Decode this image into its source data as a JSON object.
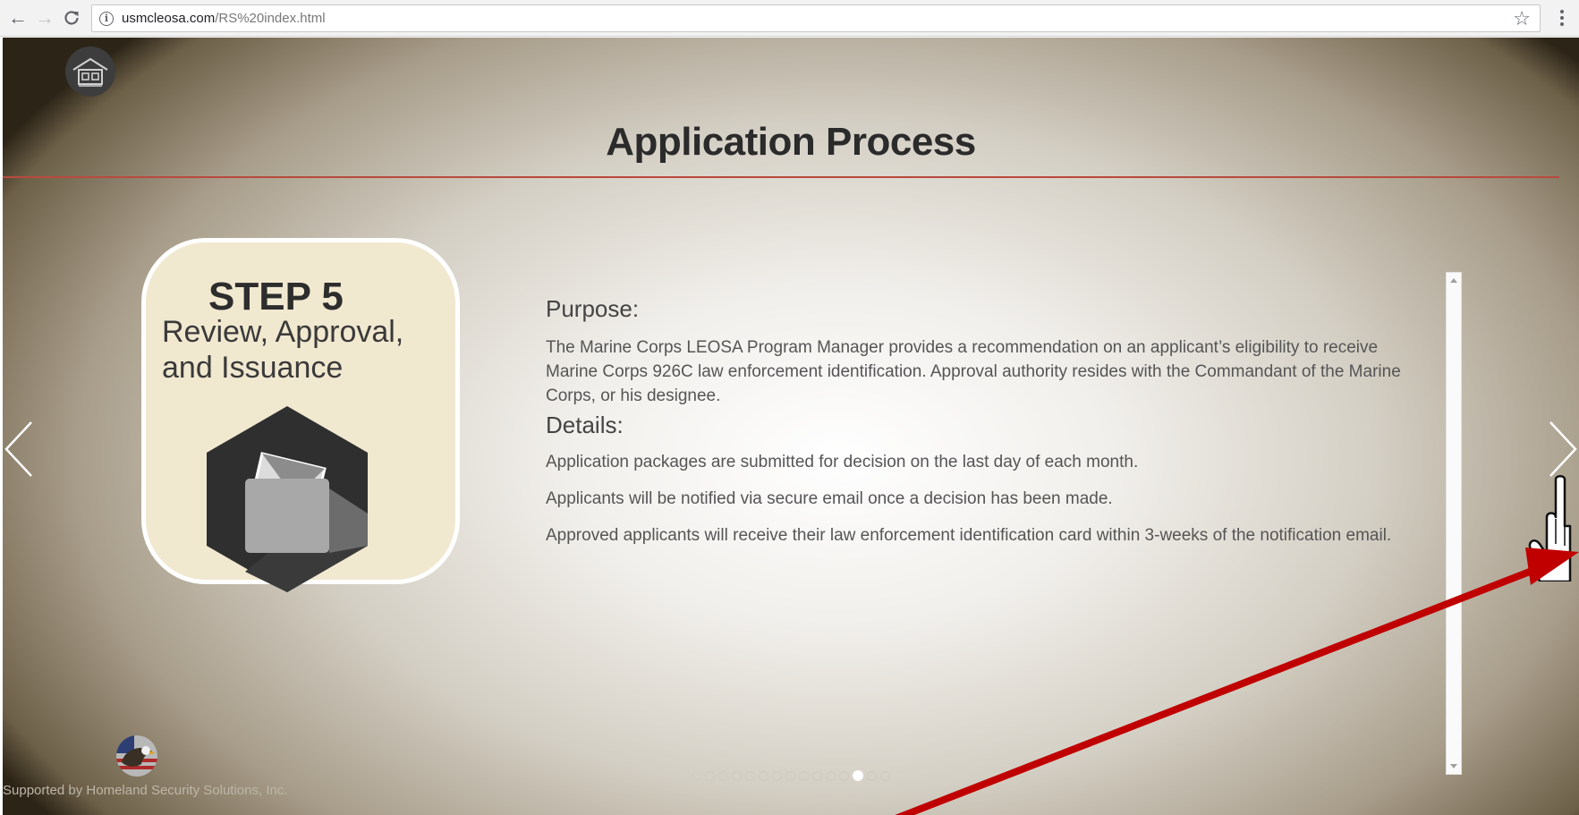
{
  "browser": {
    "url_host": "usmcleosa.com",
    "url_path": "/RS%20index.html",
    "back_icon": "arrow-left-icon",
    "forward_icon": "arrow-right-icon",
    "reload_icon": "reload-icon",
    "info_icon": "info-icon",
    "star_icon": "star-icon",
    "menu_icon": "kebab-menu-icon"
  },
  "page": {
    "title": "Application Process",
    "accent_color": "#b84a3e"
  },
  "step": {
    "number": "STEP 5",
    "name": "Review, Approval, and Issuance",
    "icon": "mailbox-envelope-icon"
  },
  "content": {
    "purpose_heading": "Purpose:",
    "purpose_text": "The Marine Corps LEOSA Program Manager provides a recommendation on an applicant’s eligibility to receive Marine Corps 926C law enforcement identification. Approval authority resides with the Commandant of the Marine Corps, or his designee.",
    "details_heading": "Details:",
    "details": [
      "Application packages are submitted for decision on the last day of each month.",
      "Applicants will be notified via secure email once a decision has been made.",
      "Approved applicants will receive their law enforcement identification card within 3-weeks of the notification email."
    ]
  },
  "pagination": {
    "total": 15,
    "current": 13
  },
  "footer": {
    "credit": "Supported by Homeland Security Solutions, Inc."
  }
}
